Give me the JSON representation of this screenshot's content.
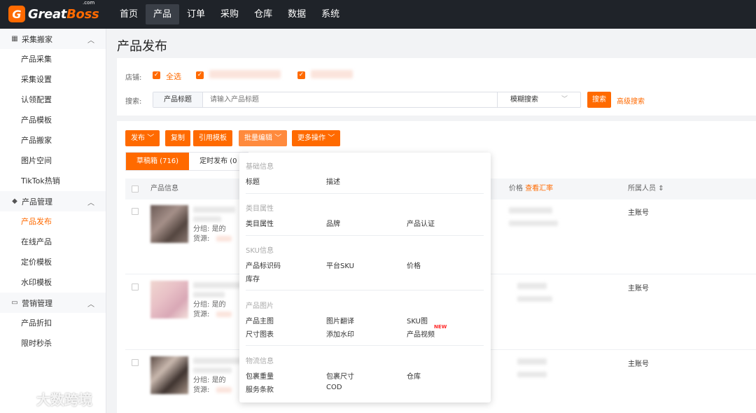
{
  "brand": {
    "mark": "G",
    "name_a": "Great",
    "name_b": "Boss",
    "suffix": ".com"
  },
  "topnav": [
    "首页",
    "产品",
    "订单",
    "采购",
    "仓库",
    "数据",
    "系统"
  ],
  "sidebar": {
    "groups": [
      {
        "label": "采集搬家",
        "items": [
          "产品采集",
          "采集设置",
          "认领配置",
          "产品模板",
          "产品搬家",
          "图片空间",
          "TikTok热销"
        ]
      },
      {
        "label": "产品管理",
        "items": [
          "产品发布",
          "在线产品",
          "定价模板",
          "水印模板"
        ]
      },
      {
        "label": "营销管理",
        "items": [
          "产品折扣",
          "限时秒杀"
        ]
      }
    ]
  },
  "page_title": "产品发布",
  "filter": {
    "store_label": "店铺:",
    "select_all": "全选",
    "search_label": "搜索:",
    "search_field": "产品标题",
    "search_placeholder": "请输入产品标题",
    "search_mode": "模糊搜索",
    "search_button": "搜索",
    "advanced_search": "高级搜索"
  },
  "toolbar": [
    "发布",
    "复制",
    "引用模板",
    "批量编辑",
    "更多操作"
  ],
  "tabs": [
    "草稿箱 (716)",
    "定时发布 (0"
  ],
  "table": {
    "col_product": "产品信息",
    "col_price": "价格",
    "col_price_link": "查看汇率",
    "col_owner": "所属人员",
    "rows": [
      {
        "group_label": "分组:",
        "group_value": "是的",
        "source_label": "货源:",
        "owner": "主账号"
      },
      {
        "group_label": "分组:",
        "group_value": "是的",
        "source_label": "货源:",
        "owner": "主账号"
      },
      {
        "group_label": "分组:",
        "group_value": "是的",
        "source_label": "货源:",
        "owner": "主账号"
      }
    ]
  },
  "dropdown": {
    "sections": [
      {
        "title": "基础信息",
        "items": [
          "标题",
          "描述"
        ]
      },
      {
        "title": "类目属性",
        "items": [
          "类目属性",
          "品牌",
          "产品认证"
        ]
      },
      {
        "title": "SKU信息",
        "items": [
          "产品标识码",
          "平台SKU",
          "价格",
          "库存"
        ]
      },
      {
        "title": "产品图片",
        "items": [
          "产品主图",
          "图片翻译",
          "SKU图",
          "尺寸图表",
          "添加水印",
          "产品视频"
        ]
      },
      {
        "title": "物流信息",
        "items": [
          "包裹重量",
          "包裹尺寸",
          "仓库",
          "服务条款",
          "COD"
        ]
      }
    ],
    "new_badge": "NEW"
  },
  "watermark": "大数跨境",
  "colors": {
    "accent": "#ff6a00",
    "topbar": "#1f2329"
  }
}
